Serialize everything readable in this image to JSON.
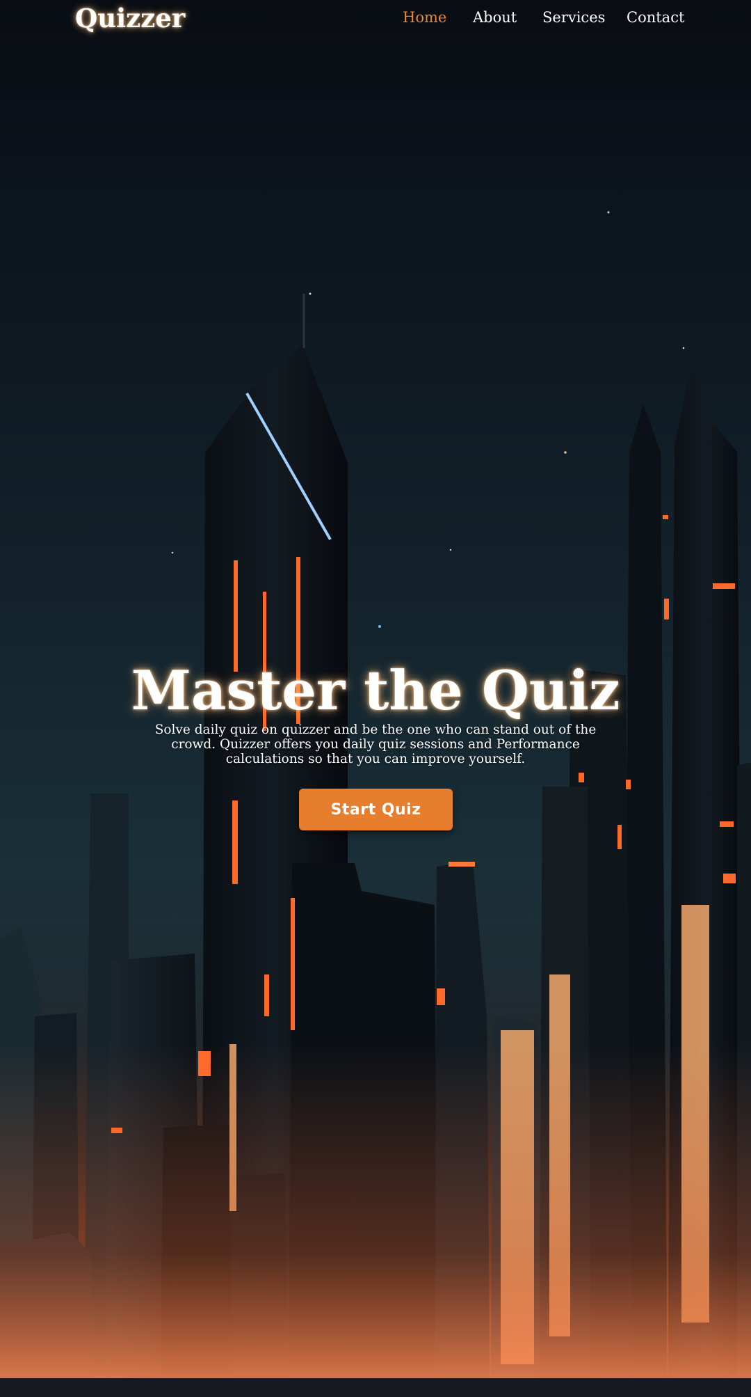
{
  "header": {
    "brand": "Quizzer",
    "nav": [
      {
        "label": "Home",
        "active": true
      },
      {
        "label": "About",
        "active": false
      },
      {
        "label": "Services",
        "active": false
      },
      {
        "label": "Contact",
        "active": false
      }
    ]
  },
  "hero": {
    "title": "Master the Quiz",
    "subtitle": "Solve daily quiz on quizzer and be the one who can stand out of the crowd. Quizzer offers you daily quiz sessions and Performance calculations so that you can improve yourself.",
    "cta_label": "Start Quiz",
    "background_image": "night-city-skyline"
  },
  "colors": {
    "accent": "#e67e2d",
    "nav_active": "#e8863a",
    "text": "#ffffff",
    "sky_dark": "#090d13"
  }
}
